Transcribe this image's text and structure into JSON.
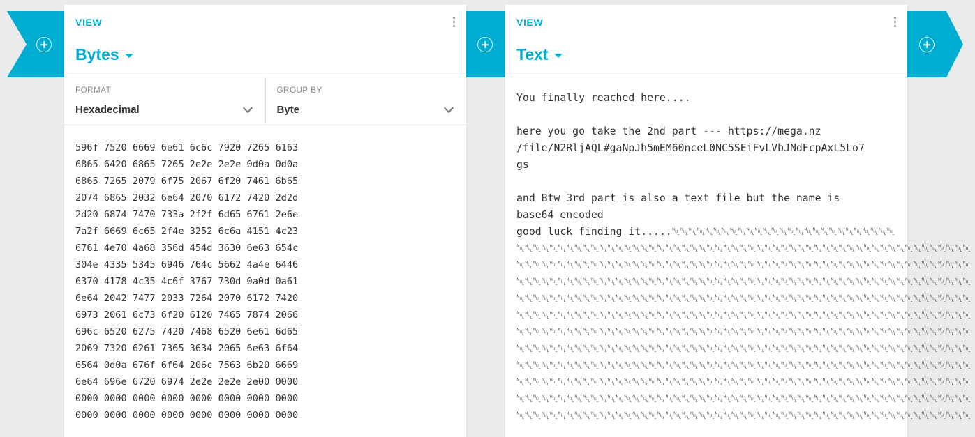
{
  "colors": {
    "accent": "#00acd0",
    "background": "#ebebeb",
    "panel": "#ffffff",
    "text": "#333333",
    "muted": "#8a8a8a"
  },
  "left_panel": {
    "view_label": "VIEW",
    "view_name": "Bytes",
    "format_label": "FORMAT",
    "format_value": "Hexadecimal",
    "group_label": "GROUP BY",
    "group_value": "Byte",
    "hex_lines": [
      "596f 7520 6669 6e61 6c6c 7920 7265 6163",
      "6865 6420 6865 7265 2e2e 2e2e 0d0a 0d0a",
      "6865 7265 2079 6f75 2067 6f20 7461 6b65",
      "2074 6865 2032 6e64 2070 6172 7420 2d2d",
      "2d20 6874 7470 733a 2f2f 6d65 6761 2e6e",
      "7a2f 6669 6c65 2f4e 3252 6c6a 4151 4c23",
      "6761 4e70 4a68 356d 454d 3630 6e63 654c",
      "304e 4335 5345 6946 764c 5662 4a4e 6446",
      "6370 4178 4c35 4c6f 3767 730d 0a0d 0a61",
      "6e64 2042 7477 2033 7264 2070 6172 7420",
      "6973 2061 6c73 6f20 6120 7465 7874 2066",
      "696c 6520 6275 7420 7468 6520 6e61 6d65",
      "2069 7320 6261 7365 3634 2065 6e63 6f64",
      "6564 0d0a 676f 6f64 206c 7563 6b20 6669",
      "6e64 696e 6720 6974 2e2e 2e2e 2e00 0000",
      "0000 0000 0000 0000 0000 0000 0000 0000",
      "0000 0000 0000 0000 0000 0000 0000 0000"
    ]
  },
  "right_panel": {
    "view_label": "VIEW",
    "view_name": "Text",
    "text_lines": [
      "You finally reached here....",
      "",
      "here you go take the 2nd part --- https://mega.nz",
      "/file/N2RljAQL#gaNpJh5mEM60nceL0NC5SEiFvLVbJNdFcpAxL5Lo7",
      "gs",
      "",
      "and Btw 3rd part is also a text file but the name is",
      "base64 encoded",
      "good luck finding it.....␀␀␀␀␀␀␀␀␀␀␀␀␀␀␀␀␀␀␀␀␀␀␀␀␀␀␀",
      "␀␀␀␀␀␀␀␀␀␀␀␀␀␀␀␀␀␀␀␀␀␀␀␀␀␀␀␀␀␀␀␀␀␀␀␀␀␀␀␀␀␀␀␀␀␀␀␀␀␀␀␀␀␀␀",
      "␀␀␀␀␀␀␀␀␀␀␀␀␀␀␀␀␀␀␀␀␀␀␀␀␀␀␀␀␀␀␀␀␀␀␀␀␀␀␀␀␀␀␀␀␀␀␀␀␀␀␀␀␀␀␀",
      "␀␀␀␀␀␀␀␀␀␀␀␀␀␀␀␀␀␀␀␀␀␀␀␀␀␀␀␀␀␀␀␀␀␀␀␀␀␀␀␀␀␀␀␀␀␀␀␀␀␀␀␀␀␀␀",
      "␀␀␀␀␀␀␀␀␀␀␀␀␀␀␀␀␀␀␀␀␀␀␀␀␀␀␀␀␀␀␀␀␀␀␀␀␀␀␀␀␀␀␀␀␀␀␀␀␀␀␀␀␀␀␀",
      "␀␀␀␀␀␀␀␀␀␀␀␀␀␀␀␀␀␀␀␀␀␀␀␀␀␀␀␀␀␀␀␀␀␀␀␀␀␀␀␀␀␀␀␀␀␀␀␀␀␀␀␀␀␀␀",
      "␀␀␀␀␀␀␀␀␀␀␀␀␀␀␀␀␀␀␀␀␀␀␀␀␀␀␀␀␀␀␀␀␀␀␀␀␀␀␀␀␀␀␀␀␀␀␀␀␀␀␀␀␀␀␀",
      "␀␀␀␀␀␀␀␀␀␀␀␀␀␀␀␀␀␀␀␀␀␀␀␀␀␀␀␀␀␀␀␀␀␀␀␀␀␀␀␀␀␀␀␀␀␀␀␀␀␀␀␀␀␀␀",
      "␀␀␀␀␀␀␀␀␀␀␀␀␀␀␀␀␀␀␀␀␀␀␀␀␀␀␀␀␀␀␀␀␀␀␀␀␀␀␀␀␀␀␀␀␀␀␀␀␀␀␀␀␀␀␀",
      "␀␀␀␀␀␀␀␀␀␀␀␀␀␀␀␀␀␀␀␀␀␀␀␀␀␀␀␀␀␀␀␀␀␀␀␀␀␀␀␀␀␀␀␀␀␀␀␀␀␀␀␀␀␀␀",
      "␀␀␀␀␀␀␀␀␀␀␀␀␀␀␀␀␀␀␀␀␀␀␀␀␀␀␀␀␀␀␀␀␀␀␀␀␀␀␀␀␀␀␀␀␀␀␀␀␀␀␀␀␀␀␀",
      "␀␀␀␀␀␀␀␀␀␀␀␀␀␀␀␀␀␀␀␀␀␀␀␀␀␀␀␀␀␀␀␀␀␀␀␀␀␀␀␀␀␀␀␀␀␀␀␀␀␀␀␀␀␀␀"
    ]
  }
}
